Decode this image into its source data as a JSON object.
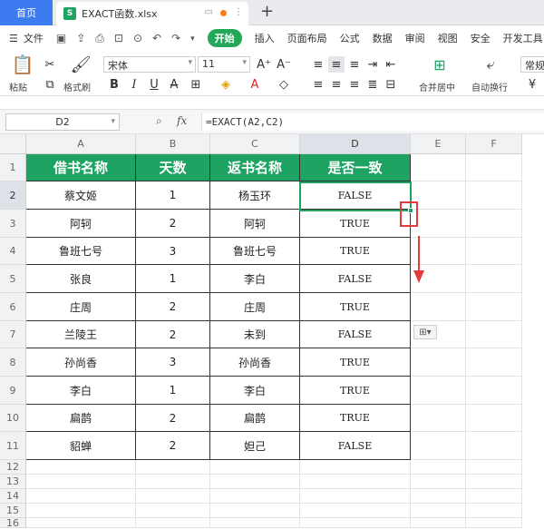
{
  "tabs": {
    "home": "首页",
    "file": "EXACT函数.xlsx",
    "new_tab": "+"
  },
  "menu": {
    "file": "文件",
    "items": [
      "开始",
      "插入",
      "页面布局",
      "公式",
      "数据",
      "审阅",
      "视图",
      "安全",
      "开发工具"
    ]
  },
  "ribbon": {
    "paste": "粘贴",
    "format_painter": "格式刷",
    "font_name": "宋体",
    "font_size": "11",
    "merge_center": "合并居中",
    "wrap": "自动换行",
    "number_format": "常规"
  },
  "formula_bar": {
    "cell_ref": "D2",
    "fx": "fx",
    "formula": "=EXACT(A2,C2)"
  },
  "columns": [
    "A",
    "B",
    "C",
    "D",
    "E",
    "F"
  ],
  "rows": [
    "1",
    "2",
    "3",
    "4",
    "5",
    "6",
    "7",
    "8",
    "9",
    "10",
    "11",
    "12",
    "13",
    "14",
    "15",
    "16"
  ],
  "table": {
    "headers": [
      "借书名称",
      "天数",
      "返书名称",
      "是否一致"
    ],
    "data": [
      [
        "蔡文姬",
        "1",
        "杨玉环",
        "FALSE"
      ],
      [
        "阿轲",
        "2",
        "阿轲",
        "TRUE"
      ],
      [
        "鲁班七号",
        "3",
        "鲁班七号",
        "TRUE"
      ],
      [
        "张良",
        "1",
        "李白",
        "FALSE"
      ],
      [
        "庄周",
        "2",
        "庄周",
        "TRUE"
      ],
      [
        "兰陵王",
        "2",
        "未到",
        "FALSE"
      ],
      [
        "孙尚香",
        "3",
        "孙尚香",
        "TRUE"
      ],
      [
        "李白",
        "1",
        "李白",
        "TRUE"
      ],
      [
        "扁鹊",
        "2",
        "扁鹊",
        "TRUE"
      ],
      [
        "貂蝉",
        "2",
        "妲己",
        "FALSE"
      ]
    ]
  },
  "colors": {
    "header_green": "#1ea362",
    "selection_green": "#1ea362",
    "annotation_red": "#e43b3b",
    "tab_blue": "#3d7cf0"
  }
}
